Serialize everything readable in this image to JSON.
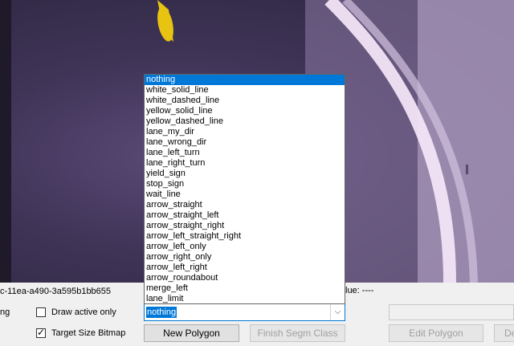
{
  "status": {
    "id_fragment": "c-11ea-a490-3a595b1bb655",
    "value_fragment": "lue: ----"
  },
  "controls": {
    "left_cut_label": "ng",
    "draw_active_only": {
      "label": "Draw active only",
      "checked": false
    },
    "target_size_bitmap": {
      "label": "Target Size Bitmap",
      "checked": true
    }
  },
  "class_select": {
    "selected": "nothing",
    "options": [
      "nothing",
      "white_solid_line",
      "white_dashed_line",
      "yellow_solid_line",
      "yellow_dashed_line",
      "lane_my_dir",
      "lane_wrong_dir",
      "lane_left_turn",
      "lane_right_turn",
      "yield_sign",
      "stop_sign",
      "wait_line",
      "arrow_straight",
      "arrow_straight_left",
      "arrow_straight_right",
      "arrow_left_straight_right",
      "arrow_left_only",
      "arrow_right_only",
      "arrow_left_right",
      "arrow_roundabout",
      "merge_left",
      "lane_limit"
    ]
  },
  "buttons": {
    "new_polygon": "New Polygon",
    "finish_segm_class": "Finish Segm Class",
    "edit_polygon": "Edit Polygon",
    "cut_right": "De"
  },
  "colors": {
    "accent": "#0078d7",
    "lane_yellow": "#e8c312",
    "road_edge": "#f2e4f5"
  }
}
